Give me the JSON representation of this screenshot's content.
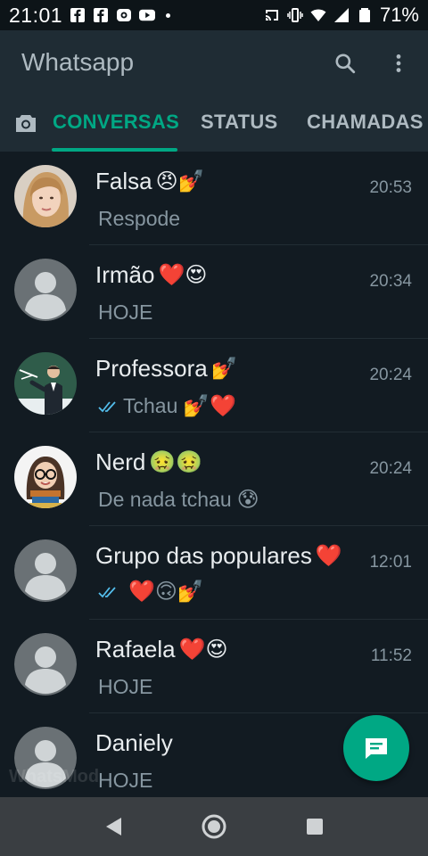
{
  "status_bar": {
    "time": "21:01",
    "battery_percent": "71%",
    "notification_icons": [
      "facebook-icon",
      "facebook-icon",
      "messenger-icon",
      "youtube-icon"
    ],
    "system_icons": [
      "cast-icon",
      "vibrate-icon",
      "wifi-icon",
      "signal-icon",
      "battery-icon"
    ]
  },
  "app_bar": {
    "title": "Whatsapp",
    "actions": [
      "search-icon",
      "more-vert-icon"
    ]
  },
  "tabs": {
    "camera_icon": "camera-icon",
    "items": [
      {
        "label": "CONVERSAS",
        "active": true
      },
      {
        "label": "STATUS",
        "active": false
      },
      {
        "label": "CHAMADAS",
        "active": false
      }
    ]
  },
  "chats": [
    {
      "name": "Falsa",
      "name_emoji": "😠💅",
      "time": "20:53",
      "preview": "Respode",
      "preview_prefix_emoji": "",
      "preview_suffix_emoji": "",
      "ticks": false,
      "avatar": "photo"
    },
    {
      "name": "Irmão",
      "name_emoji": "❤️😍",
      "time": "20:34",
      "preview": "HOJE",
      "preview_prefix_emoji": "",
      "preview_suffix_emoji": "",
      "ticks": false,
      "avatar": "default"
    },
    {
      "name": "Professora",
      "name_emoji": "💅",
      "time": "20:24",
      "preview": "Tchau",
      "preview_prefix_emoji": "",
      "preview_suffix_emoji": "💅❤️",
      "ticks": true,
      "avatar": "photo"
    },
    {
      "name": "Nerd",
      "name_emoji": "🤢🤢",
      "time": "20:24",
      "preview": "De nada tchau",
      "preview_prefix_emoji": "",
      "preview_suffix_emoji": "😰",
      "ticks": false,
      "avatar": "photo"
    },
    {
      "name": "Grupo das populares",
      "name_emoji": "❤️",
      "time": "12:01",
      "preview": "",
      "preview_prefix_emoji": "",
      "preview_suffix_emoji": "❤️🙃💅",
      "ticks": true,
      "avatar": "default"
    },
    {
      "name": "Rafaela",
      "name_emoji": "❤️😍",
      "time": "11:52",
      "preview": "HOJE",
      "preview_prefix_emoji": "",
      "preview_suffix_emoji": "",
      "ticks": false,
      "avatar": "default"
    },
    {
      "name": "Daniely",
      "name_emoji": "",
      "time": "",
      "preview": "HOJE",
      "preview_prefix_emoji": "",
      "preview_suffix_emoji": "",
      "ticks": false,
      "avatar": "default"
    }
  ],
  "fab": {
    "icon": "new-chat-icon"
  },
  "watermark": "WhatsMod",
  "nav_bar": {
    "buttons": [
      "back-icon",
      "home-icon",
      "recents-icon"
    ]
  },
  "colors": {
    "accent": "#00a884",
    "background": "#121b22",
    "app_bar": "#1f2c34",
    "read_ticks": "#53bdeb"
  }
}
